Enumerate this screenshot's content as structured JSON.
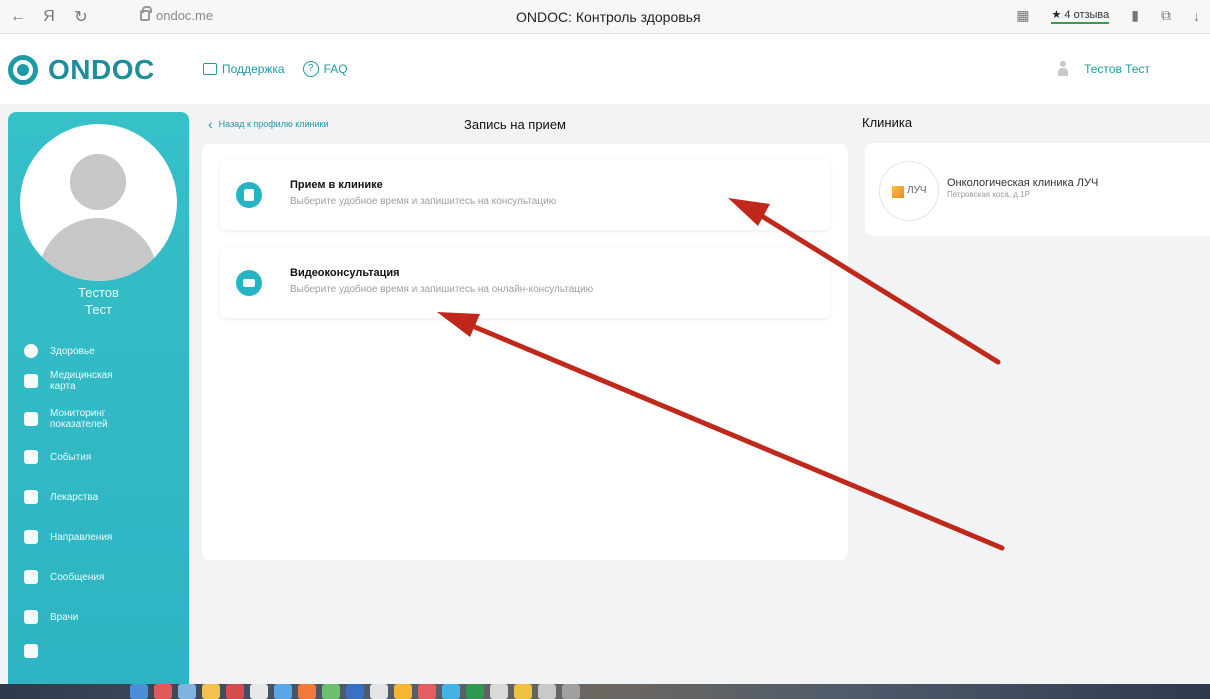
{
  "browser": {
    "url": "ondoc.me",
    "tab_title": "ONDOC: Контроль здоровья",
    "reviews": "4 отзыва",
    "yandex_glyph": "Я"
  },
  "header": {
    "logo_text": "ONDOC",
    "links": [
      {
        "label": "Поддержка",
        "icon": "support-icon"
      },
      {
        "label": "FAQ",
        "icon": "faq-icon"
      }
    ],
    "user_name": "Тестов Тест"
  },
  "sidebar": {
    "first_name": "Тестов",
    "last_name": "Тест",
    "items": [
      {
        "label": "Здоровье",
        "icon": "heart-icon"
      },
      {
        "label": "Медицинская карта",
        "icon": "medical-card-icon"
      },
      {
        "label": "Мониторинг показателей",
        "icon": "monitoring-icon"
      },
      {
        "label": "События",
        "icon": "calendar-icon"
      },
      {
        "label": "Лекарства",
        "icon": "pills-icon"
      },
      {
        "label": "Направления",
        "icon": "referral-icon"
      },
      {
        "label": "Сообщения",
        "icon": "messages-icon"
      },
      {
        "label": "Врачи",
        "icon": "doctors-icon"
      }
    ]
  },
  "main": {
    "back_link": "Назад к профилю клиники",
    "title": "Запись на прием",
    "options": [
      {
        "title": "Прием в клинике",
        "subtitle": "Выберите удобное время и запишитесь на консультацию",
        "icon": "hospital-icon"
      },
      {
        "title": "Видеоконсультация",
        "subtitle": "Выберите удобное время и запишитесь на онлайн-консультацию",
        "icon": "video-icon"
      }
    ]
  },
  "right": {
    "header": "Клиника",
    "clinic": {
      "logo_text": "ЛУЧ",
      "name": "Онкологическая клиника ЛУЧ",
      "address": "Петровская коса, д.1Р"
    }
  },
  "colors": {
    "accent": "#1e9aa6",
    "sidebar": "#36c0c8",
    "annotation_arrow": "#c0281b"
  }
}
